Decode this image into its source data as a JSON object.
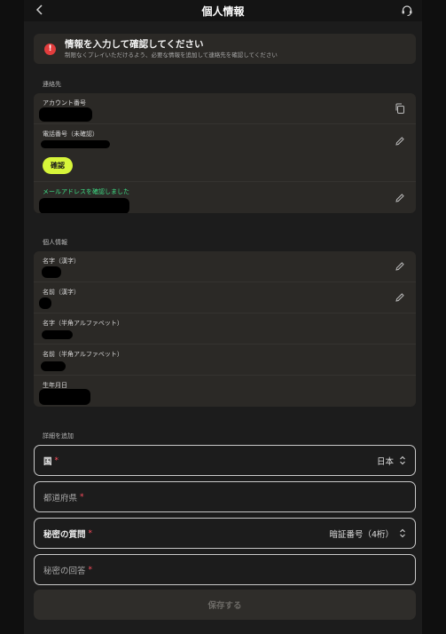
{
  "header": {
    "title": "個人情報",
    "back_icon": "chevron-left-icon",
    "support_icon": "headset-icon"
  },
  "alert": {
    "icon": "exclamation-icon",
    "title": "情報を入力して確認してください",
    "subtitle": "制限なくプレイいただけるよう、必要な情報を追加して連絡先を確認してください"
  },
  "contact": {
    "section_label": "連絡先",
    "account_label": "アカウント番号",
    "phone_label": "電話番号（未確認）",
    "confirm_label": "確認",
    "email_label": "メールアドレスを確認しました"
  },
  "personal": {
    "section_label": "個人情報",
    "last_name_kanji": "名字（漢字）",
    "first_name_kanji": "名前（漢字）",
    "last_name_alpha": "名字（半角アルファベット）",
    "first_name_alpha": "名前（半角アルファベット）",
    "birthdate": "生年月日"
  },
  "details": {
    "section_label": "詳細を追加",
    "country_label": "国",
    "country_value": "日本",
    "prefecture_placeholder": "都道府県",
    "secret_question_label": "秘密の質問",
    "secret_question_value": "暗証番号（4桁）",
    "secret_answer_placeholder": "秘密の回答",
    "required_mark": "*"
  },
  "footer": {
    "save_label": "保存する"
  },
  "colors": {
    "accent": "#d7f53a",
    "verified": "#3ddc84",
    "error": "#e23d3d",
    "required": "#ff4d5e"
  }
}
